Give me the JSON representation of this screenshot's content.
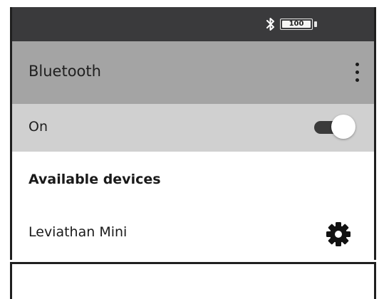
{
  "status_bar": {
    "bluetooth_icon": "bluetooth-icon",
    "battery_level": "100",
    "battery_fraction": 1.0
  },
  "app_bar": {
    "title": "Bluetooth",
    "menu_icon": "more-vert-icon"
  },
  "bluetooth_toggle": {
    "label": "On",
    "state": true
  },
  "available_devices": {
    "header": "Available devices",
    "items": [
      {
        "name": "Leviathan Mini",
        "action_icon": "gear-icon"
      }
    ]
  },
  "colors": {
    "status_bar": "#3a3a3c",
    "app_bar": "#a4a4a4",
    "toggle_row": "#d0d0d0",
    "switch_track_on": "#3a3a3a"
  }
}
